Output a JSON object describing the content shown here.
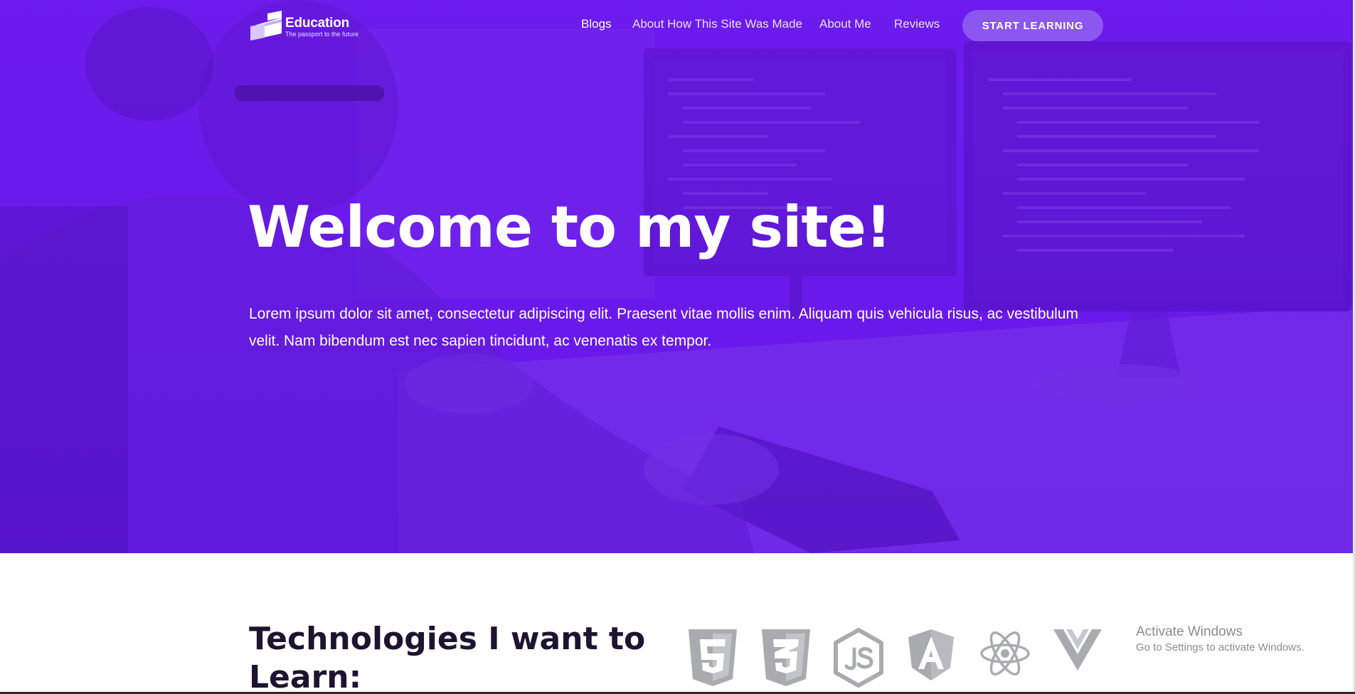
{
  "logo": {
    "title": "Education",
    "tagline": "The passport to the future"
  },
  "nav": {
    "items": [
      {
        "label": "Blogs",
        "active": true
      },
      {
        "label": "About How This Site Was Made",
        "active": false
      },
      {
        "label": "About Me",
        "active": false
      },
      {
        "label": "Reviews",
        "active": false
      }
    ],
    "cta_label": "START LEARNING"
  },
  "hero": {
    "title": "Welcome to my site!",
    "text": "Lorem ipsum dolor sit amet, consectetur adipiscing elit. Praesent vitae mollis enim. Aliquam quis vehicula risus, ac vestibulum velit. Nam bibendum est nec sapien tincidunt, ac venenatis ex tempor."
  },
  "technologies": {
    "title": "Technologies I want to Learn:",
    "icons": [
      "html5-icon",
      "css3-icon",
      "nodejs-icon",
      "angular-icon",
      "react-icon",
      "vue-icon"
    ]
  },
  "watermark": {
    "title": "Activate Windows",
    "subtitle": "Go to Settings to activate Windows."
  },
  "colors": {
    "hero_purple": "#6418e6",
    "cta_purple": "#8b57ee",
    "heading_dark": "#1b1530",
    "icon_gray": "#a9abad"
  }
}
